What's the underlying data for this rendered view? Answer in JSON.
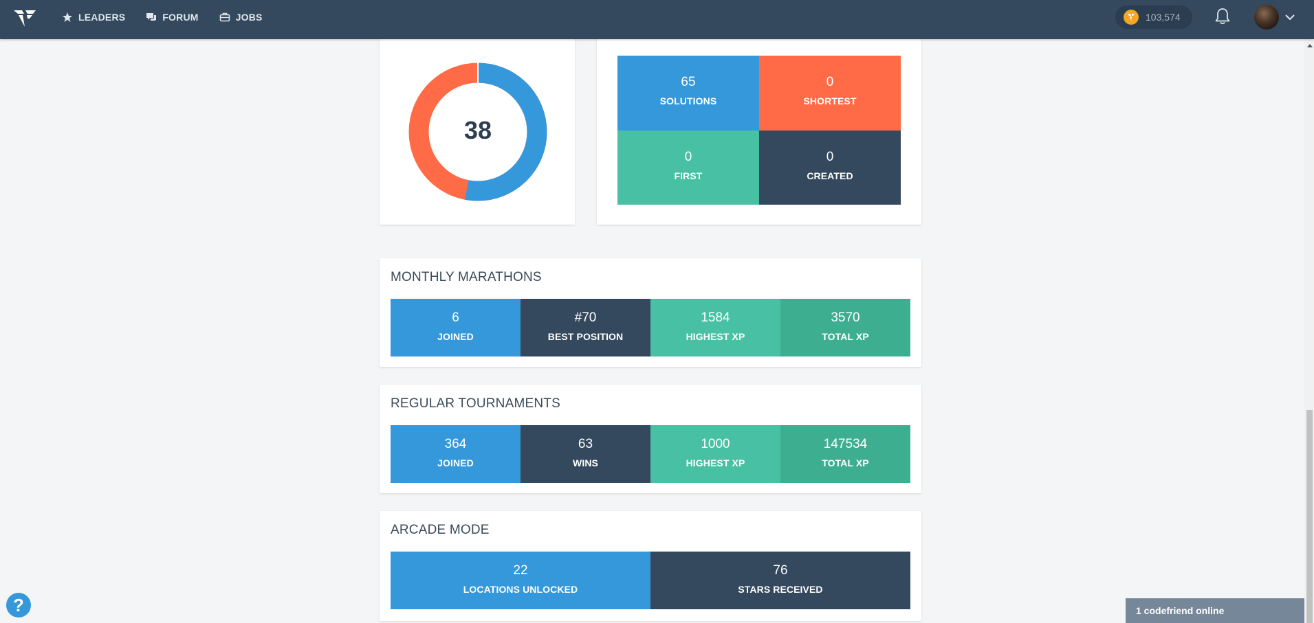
{
  "nav": {
    "leaders": "LEADERS",
    "forum": "FORUM",
    "jobs": "JOBS",
    "coins": "103,574"
  },
  "puzzles": {
    "donut_value": "38",
    "donut_fraction_blue": 0.53
  },
  "solutions": {
    "tiles": [
      {
        "value": "65",
        "label": "SOLUTIONS"
      },
      {
        "value": "0",
        "label": "SHORTEST"
      },
      {
        "value": "0",
        "label": "FIRST"
      },
      {
        "value": "0",
        "label": "CREATED"
      }
    ]
  },
  "marathons": {
    "title": "MONTHLY MARATHONS",
    "tiles": [
      {
        "value": "6",
        "label": "JOINED"
      },
      {
        "value": "#70",
        "label": "BEST POSITION"
      },
      {
        "value": "1584",
        "label": "HIGHEST XP"
      },
      {
        "value": "3570",
        "label": "TOTAL XP"
      }
    ]
  },
  "tournaments": {
    "title": "REGULAR TOURNAMENTS",
    "tiles": [
      {
        "value": "364",
        "label": "JOINED"
      },
      {
        "value": "63",
        "label": "WINS"
      },
      {
        "value": "1000",
        "label": "HIGHEST XP"
      },
      {
        "value": "147534",
        "label": "TOTAL XP"
      }
    ]
  },
  "arcade": {
    "title": "ARCADE MODE",
    "tiles": [
      {
        "value": "22",
        "label": "LOCATIONS UNLOCKED"
      },
      {
        "value": "76",
        "label": "STARS RECEIVED"
      }
    ]
  },
  "help": {
    "glyph": "?"
  },
  "online": {
    "text": "1 codefriend online"
  },
  "colors": {
    "blue": "#3498db",
    "navy": "#34495e",
    "orange": "#ff6b46",
    "teal": "#48c0a3",
    "teal_dark": "#3eae91"
  }
}
